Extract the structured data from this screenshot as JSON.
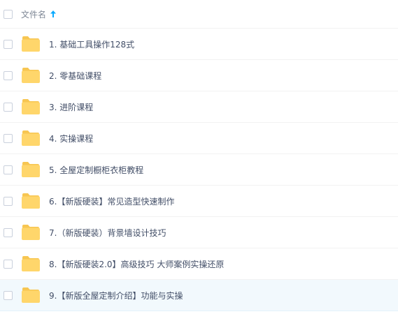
{
  "header": {
    "column_label": "文件名",
    "sort_icon": "arrow-up-icon"
  },
  "files": [
    {
      "name": "1. 基础工具操作128式",
      "icon": "folder-icon"
    },
    {
      "name": "2. 零基础课程",
      "icon": "folder-icon"
    },
    {
      "name": "3. 进阶课程",
      "icon": "folder-icon"
    },
    {
      "name": "4. 实操课程",
      "icon": "folder-icon"
    },
    {
      "name": "5. 全屋定制橱柜衣柜教程",
      "icon": "folder-icon"
    },
    {
      "name": "6.【新版硬装】常见造型快速制作",
      "icon": "folder-icon"
    },
    {
      "name": "7.（新版硬装）背景墙设计技巧",
      "icon": "folder-icon"
    },
    {
      "name": "8.【新版硬装2.0】高级技巧 大师案例实操还原",
      "icon": "folder-icon"
    },
    {
      "name": "9.【新版全屋定制介绍】功能与实操",
      "icon": "folder-icon"
    }
  ],
  "colors": {
    "folder": "#ffd66b",
    "folder_tab": "#f7c652",
    "sort_arrow": "#09aaff",
    "selected_row_bg": "#f2f9fd"
  }
}
